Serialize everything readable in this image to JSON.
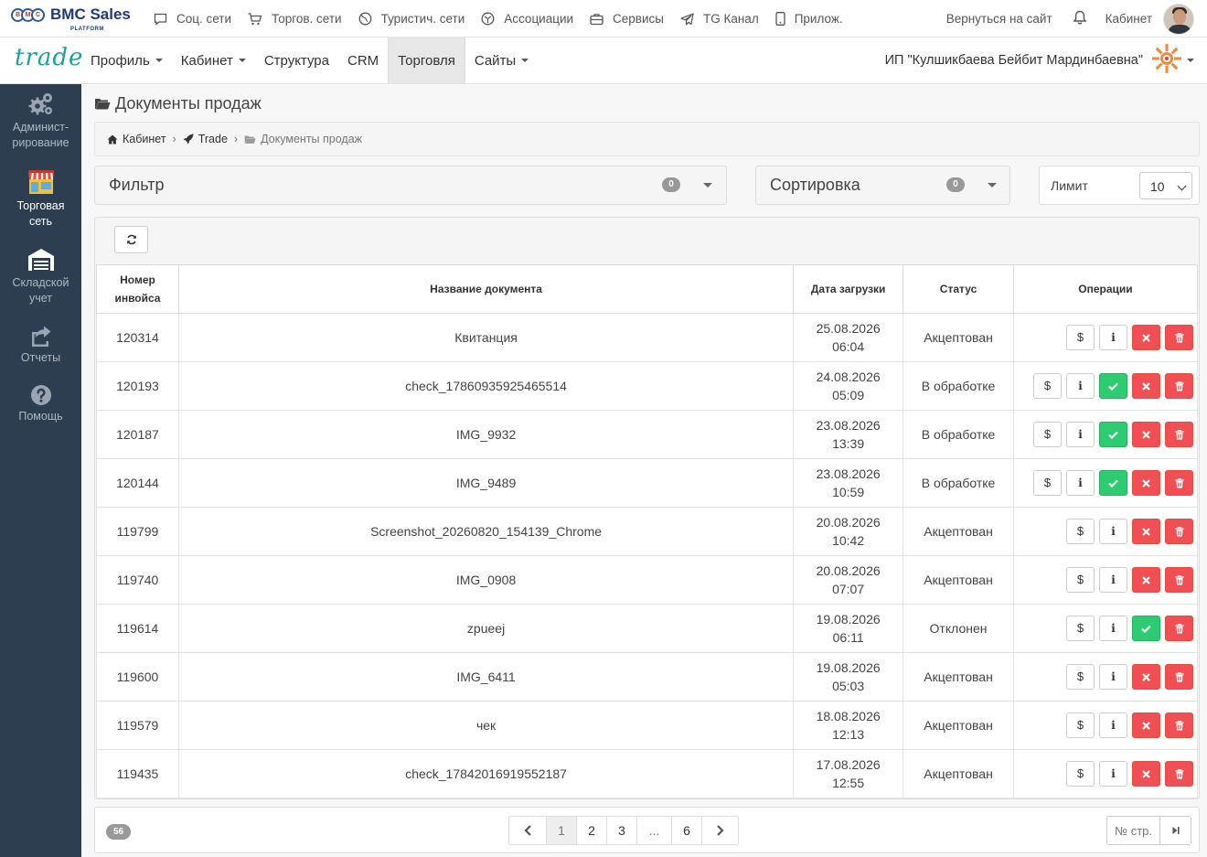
{
  "topbar": {
    "logo_text": "BMC Sales",
    "logo_sub": "PLATFORM",
    "nav": [
      {
        "label": "Соц. сети",
        "icon": "chat-icon"
      },
      {
        "label": "Торгов. сети",
        "icon": "cart-icon"
      },
      {
        "label": "Туристич. сети",
        "icon": "globe-icon"
      },
      {
        "label": "Ассоциации",
        "icon": "association-icon"
      },
      {
        "label": "Сервисы",
        "icon": "briefcase-icon"
      },
      {
        "label": "TG Канал",
        "icon": "telegram-icon"
      },
      {
        "label": "Прилож.",
        "icon": "mobile-icon"
      }
    ],
    "back_label": "Вернуться на сайт",
    "cabinet_label": "Кабинет"
  },
  "secbar": {
    "brand": "trade",
    "nav": [
      {
        "label": "Профиль",
        "dropdown": true
      },
      {
        "label": "Кабинет",
        "dropdown": true
      },
      {
        "label": "Структура",
        "dropdown": false
      },
      {
        "label": "CRM",
        "dropdown": false
      },
      {
        "label": "Торговля",
        "dropdown": false,
        "active": true
      },
      {
        "label": "Сайты",
        "dropdown": true
      }
    ],
    "org_name": "ИП \"Кулшикбаева Бейбит Мардинбаевна\""
  },
  "sidebar": [
    {
      "label1": "Админист-",
      "label2": "рирование",
      "icon": "gears-icon"
    },
    {
      "label1": "Торговая",
      "label2": "сеть",
      "icon": "store-icon",
      "active": true
    },
    {
      "label1": "Складской",
      "label2": "учет",
      "icon": "warehouse-icon"
    },
    {
      "label1": "Отчеты",
      "label2": "",
      "icon": "share-icon"
    },
    {
      "label1": "Помощь",
      "label2": "",
      "icon": "help-icon"
    }
  ],
  "page": {
    "title": "Документы продаж",
    "breadcrumb": [
      "Кабинет",
      "Trade",
      "Документы продаж"
    ]
  },
  "filter": {
    "label": "Фильтр",
    "count": "0"
  },
  "sort": {
    "label": "Сортировка",
    "count": "0"
  },
  "limit": {
    "label": "Лимит",
    "value": "10"
  },
  "table": {
    "headers": [
      "Номер инвойса",
      "Название документа",
      "Дата загрузки",
      "Статус",
      "Операции"
    ],
    "rows": [
      {
        "id": "120314",
        "name": "Квитанция",
        "date": "25.08.2026",
        "time": "06:04",
        "status": "Акцептован",
        "buttons": [
          "dollar",
          "info",
          "reject",
          "delete"
        ]
      },
      {
        "id": "120193",
        "name": "check_17860935925465514",
        "date": "24.08.2026",
        "time": "05:09",
        "status": "В обработке",
        "buttons": [
          "dollar",
          "info",
          "accept",
          "reject",
          "delete"
        ]
      },
      {
        "id": "120187",
        "name": "IMG_9932",
        "date": "23.08.2026",
        "time": "13:39",
        "status": "В обработке",
        "buttons": [
          "dollar",
          "info",
          "accept",
          "reject",
          "delete"
        ]
      },
      {
        "id": "120144",
        "name": "IMG_9489",
        "date": "23.08.2026",
        "time": "10:59",
        "status": "В обработке",
        "buttons": [
          "dollar",
          "info",
          "accept",
          "reject",
          "delete"
        ]
      },
      {
        "id": "119799",
        "name": "Screenshot_20260820_154139_Chrome",
        "date": "20.08.2026",
        "time": "10:42",
        "status": "Акцептован",
        "buttons": [
          "dollar",
          "info",
          "reject",
          "delete"
        ]
      },
      {
        "id": "119740",
        "name": "IMG_0908",
        "date": "20.08.2026",
        "time": "07:07",
        "status": "Акцептован",
        "buttons": [
          "dollar",
          "info",
          "reject",
          "delete"
        ]
      },
      {
        "id": "119614",
        "name": "zpueej",
        "date": "19.08.2026",
        "time": "06:11",
        "status": "Отклонен",
        "buttons": [
          "dollar",
          "info",
          "accept",
          "delete"
        ]
      },
      {
        "id": "119600",
        "name": "IMG_6411",
        "date": "19.08.2026",
        "time": "05:03",
        "status": "Акцептован",
        "buttons": [
          "dollar",
          "info",
          "reject",
          "delete"
        ]
      },
      {
        "id": "119579",
        "name": "чек",
        "date": "18.08.2026",
        "time": "12:13",
        "status": "Акцептован",
        "buttons": [
          "dollar",
          "info",
          "reject",
          "delete"
        ]
      },
      {
        "id": "119435",
        "name": "check_17842016919552187",
        "date": "17.08.2026",
        "time": "12:55",
        "status": "Акцептован",
        "buttons": [
          "dollar",
          "info",
          "reject",
          "delete"
        ]
      }
    ]
  },
  "pagination": {
    "total": "56",
    "pages": [
      "1",
      "2",
      "3",
      "...",
      "6"
    ],
    "current": "1",
    "jump_placeholder": "№ стр."
  }
}
